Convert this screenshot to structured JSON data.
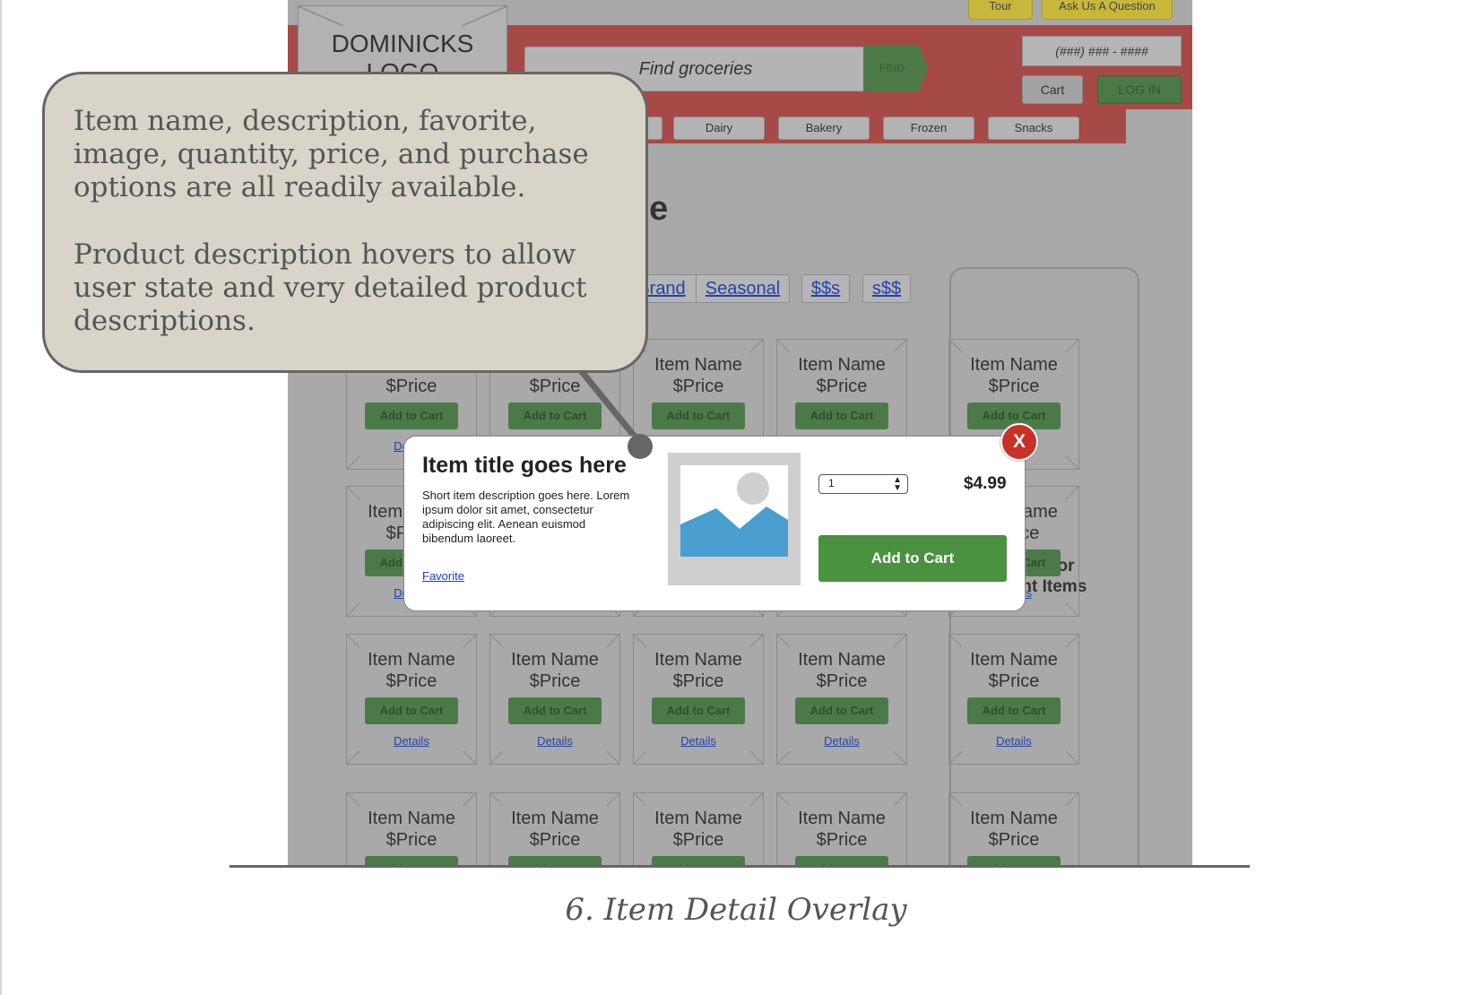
{
  "header": {
    "tour_label": "Tour",
    "ask_label": "Ask Us A Question",
    "logo_text": "DOMINICKS LOGO",
    "search_placeholder": "Find groceries",
    "find_label": "FIND",
    "phone": "(###) ### - ####",
    "cart_label": "Cart",
    "login_label": "LOG IN"
  },
  "categories": [
    "e",
    "Dairy",
    "Bakery",
    "Frozen",
    "Snacks"
  ],
  "heading_fragment": "ce",
  "filters": [
    "Brand",
    "Seasonal",
    "$$s",
    "s$$"
  ],
  "featured_title": "Featured or Recent Items",
  "tile": {
    "name": "Item Name",
    "price": "$Price",
    "add_label": "Add to Cart",
    "details_label": "Details"
  },
  "callout": {
    "paragraph_1": "Item name, description, favorite, image, quantity, price, and purchase options are all readily available.",
    "paragraph_2": "Product description hovers to allow user state and very detailed product descriptions."
  },
  "overlay": {
    "title": "Item title goes here",
    "description": "Short item description goes here. Lorem ipsum dolor sit amet, consectetur adipiscing elit. Aenean euismod bibendum laoreet.",
    "favorite_label": "Favorite",
    "quantity": "1",
    "price": "$4.99",
    "add_label": "Add to Cart",
    "close_label": "X"
  },
  "caption": "6. Item Detail Overlay",
  "colors": {
    "header_red": "#a64a47",
    "button_green": "#4a9140",
    "close_red": "#c83127",
    "link_blue": "#1a40c0",
    "callout_bg": "#d8d4c8"
  }
}
